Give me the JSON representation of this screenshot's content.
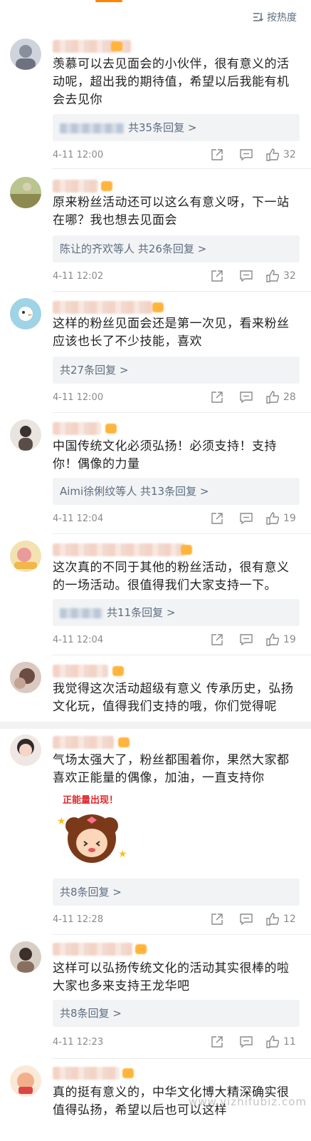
{
  "sort": {
    "label": "按热度",
    "icon": "sort-icon"
  },
  "comments": [
    {
      "text": "羡慕可以去见面会的小伙伴，很有意义的活动呢，超出我的期待值，希望以后我能有机会去见你",
      "replies": "共35条回复 >",
      "replies_names": "",
      "time": "4-11 12:00",
      "likes": "32"
    },
    {
      "text": "原来粉丝活动还可以这么有意义呀，下一站在哪？我也想去见面会",
      "replies": "共26条回复 >",
      "replies_names": "陈让的齐欢等人",
      "time": "4-11 12:02",
      "likes": "32"
    },
    {
      "text": "这样的粉丝见面会还是第一次见，看来粉丝应该也长了不少技能，喜欢",
      "replies": "共27条回复 >",
      "replies_names": "",
      "time": "4-11 12:00",
      "likes": "28"
    },
    {
      "text": "中国传统文化必须弘扬！必须支持！支持你！偶像的力量",
      "replies": "共13条回复 >",
      "replies_names": "Aimi徐俐纹等人",
      "time": "4-11 12:04",
      "likes": "19"
    },
    {
      "text": "这次真的不同于其他的粉丝活动，很有意义的一场活动。很值得我们大家支持一下。",
      "replies": "共11条回复 >",
      "replies_names": "",
      "time": "4-11 12:04",
      "likes": "19"
    },
    {
      "text": "我觉得这次活动超级有意义 传承历史，弘扬文化玩，值得我们支持的哦，你们觉得呢"
    },
    {
      "text": "气场太强大了，粉丝都围着你，果然大家都喜欢正能量的偶像，加油，一直支持你",
      "sticker_text": "正能量出现！",
      "replies": "共8条回复 >",
      "time": "4-11 12:28",
      "likes": "12"
    },
    {
      "text": "这样可以弘扬传统文化的活动其实很棒的啦大家也多来支持王龙华吧",
      "replies": "共8条回复 >",
      "time": "4-11 12:23",
      "likes": "11"
    },
    {
      "text": "真的挺有意义的，中华文化博大精深确实很值得弘扬，希望以后也可以这样"
    }
  ],
  "watermark": "www.yizhifubiz.com"
}
